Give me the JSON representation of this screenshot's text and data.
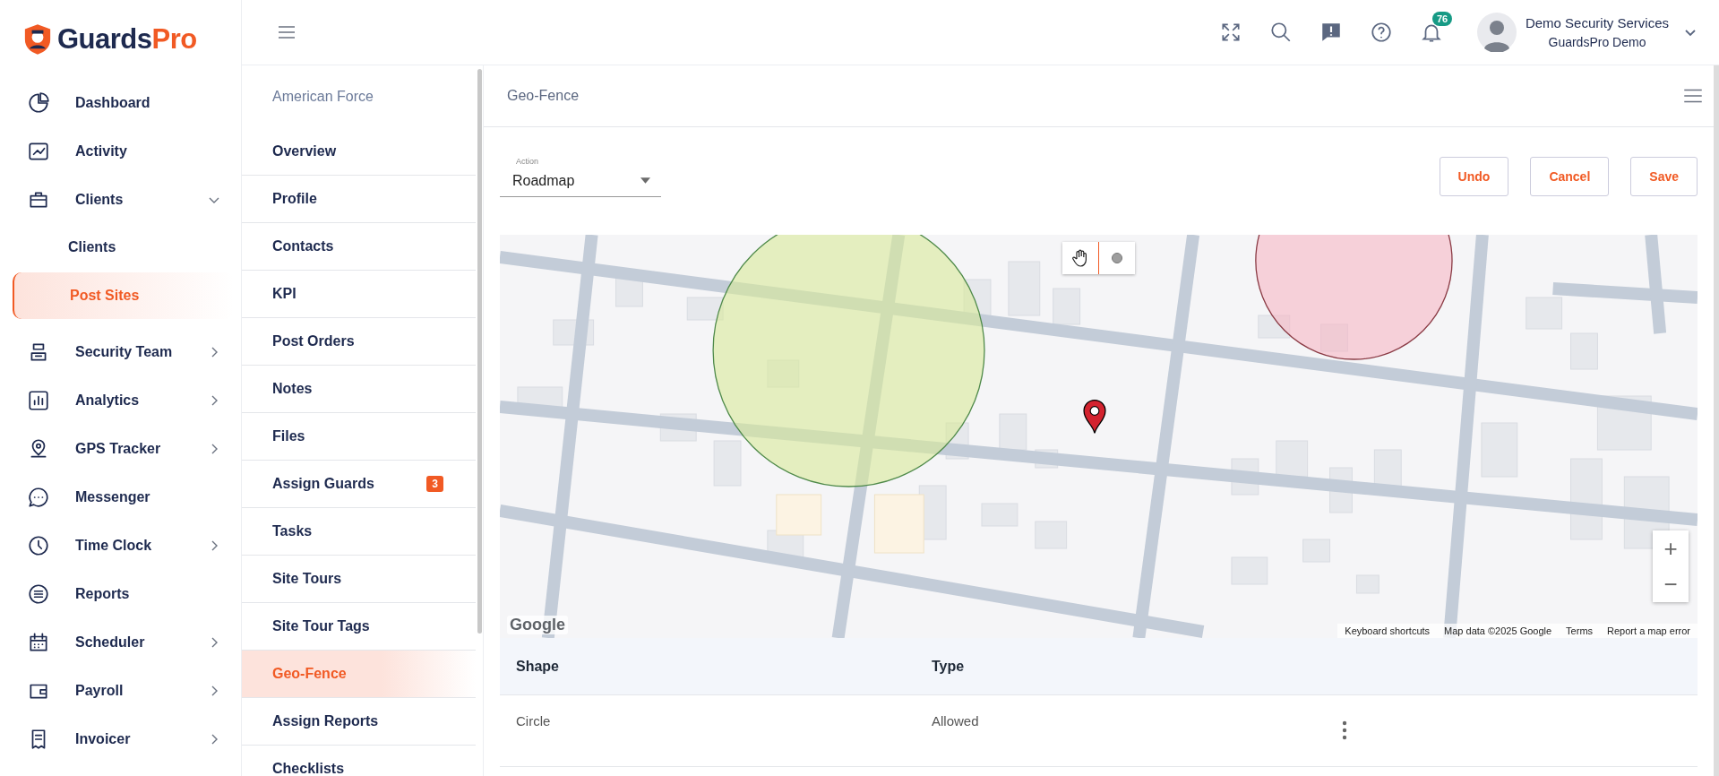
{
  "logo": {
    "part_1": "Guards",
    "part_2": "Pro"
  },
  "sidebar": {
    "items": [
      {
        "label": "Dashboard",
        "selected": false
      },
      {
        "label": "Activity",
        "selected": false
      },
      {
        "label": "Clients",
        "selected": false,
        "expanded": true,
        "children": [
          {
            "label": "Clients",
            "selected": false
          },
          {
            "label": "Post Sites",
            "selected": true
          }
        ]
      },
      {
        "label": "Security Team",
        "selected": false,
        "expanded": false
      },
      {
        "label": "Analytics",
        "selected": false,
        "expanded": false
      },
      {
        "label": "GPS Tracker",
        "selected": false,
        "expanded": false
      },
      {
        "label": "Messenger",
        "selected": false
      },
      {
        "label": "Time Clock",
        "selected": false,
        "expanded": false
      },
      {
        "label": "Reports",
        "selected": false
      },
      {
        "label": "Scheduler",
        "selected": false,
        "expanded": false
      },
      {
        "label": "Payroll",
        "selected": false,
        "expanded": false
      },
      {
        "label": "Invoicer",
        "selected": false,
        "expanded": false
      }
    ]
  },
  "topbar": {
    "notification_count": "76",
    "user_name": "Demo Security Services",
    "company": "GuardsPro Demo"
  },
  "site_menu": {
    "title": "American Force",
    "items": [
      {
        "label": "Overview",
        "selected": false
      },
      {
        "label": "Profile",
        "selected": false
      },
      {
        "label": "Contacts",
        "selected": false
      },
      {
        "label": "KPI",
        "selected": false
      },
      {
        "label": "Post Orders",
        "selected": false
      },
      {
        "label": "Notes",
        "selected": false
      },
      {
        "label": "Files",
        "selected": false
      },
      {
        "label": "Assign Guards",
        "selected": false,
        "badge": "3"
      },
      {
        "label": "Tasks",
        "selected": false
      },
      {
        "label": "Site Tours",
        "selected": false
      },
      {
        "label": "Site Tour Tags",
        "selected": false
      },
      {
        "label": "Geo-Fence",
        "selected": true
      },
      {
        "label": "Assign Reports",
        "selected": false
      },
      {
        "label": "Checklists",
        "selected": false
      }
    ]
  },
  "panel": {
    "title": "Geo-Fence",
    "action": {
      "label": "Action",
      "value": "Roadmap"
    },
    "buttons": [
      "Undo",
      "Cancel",
      "Save"
    ],
    "map": {
      "logo": "Google",
      "attribution": [
        "Keyboard shortcuts",
        "Map data ©2025 Google",
        "Terms",
        "Report a map error"
      ],
      "zoom_in": "+",
      "zoom_out": "−"
    },
    "table": {
      "columns": [
        "Shape",
        "Type"
      ],
      "rows": [
        [
          "Circle",
          "Allowed"
        ]
      ]
    }
  }
}
